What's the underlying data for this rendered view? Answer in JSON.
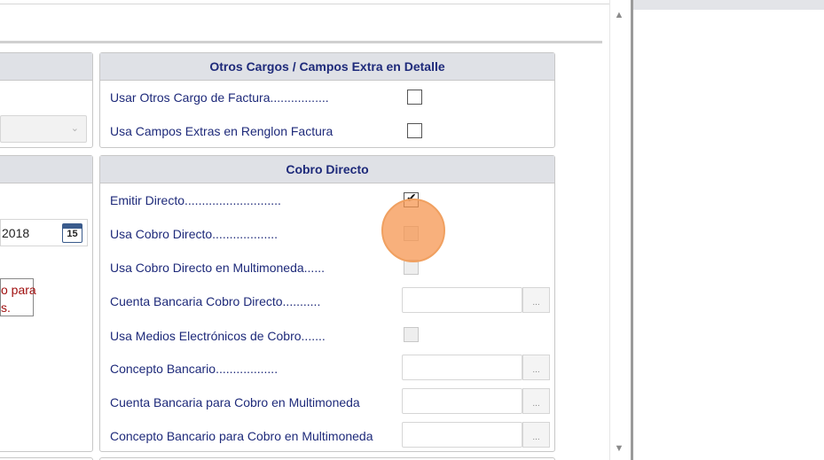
{
  "otros_cargos": {
    "title": "Otros Cargos / Campos Extra en Detalle",
    "rows": [
      {
        "label": "Usar Otros Cargo de Factura.................",
        "checked": false
      },
      {
        "label": "Usa Campos Extras en Renglon Factura",
        "checked": false
      }
    ]
  },
  "cobro_directo": {
    "title": "Cobro Directo",
    "emitir_directo": "Emitir Directo............................",
    "usa_cobro_directo": "Usa Cobro Directo...................",
    "usa_cobro_multimoneda": "Usa Cobro Directo en Multimoneda......",
    "cuenta_bancaria": "Cuenta Bancaria Cobro Directo...........",
    "medios_electronicos": "Usa Medios Electrónicos de Cobro.......",
    "concepto_bancario": "Concepto Bancario..................",
    "cuenta_multimoneda": "Cuenta Bancaria para Cobro en Multimoneda",
    "concepto_multimoneda": "Concepto Bancario para Cobro en Multimoneda",
    "lookup_button": "..."
  },
  "left": {
    "date_value": "2018",
    "calendar_day": "15",
    "message_line1": "o para",
    "message_line2": "s."
  }
}
